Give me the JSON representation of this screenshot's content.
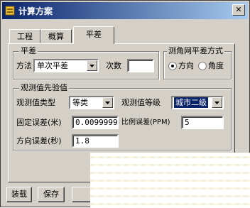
{
  "window": {
    "title": "计算方案"
  },
  "tabs": [
    {
      "label": "工程"
    },
    {
      "label": "概算"
    },
    {
      "label": "平差"
    }
  ],
  "adjust": {
    "group_title": "平差",
    "method_label": "方法",
    "method_value": "单次平差",
    "iterations_label": "次数",
    "iterations_value": ""
  },
  "angle_mode": {
    "group_title": "测角网平差方式",
    "option_direction": "方向",
    "option_angle": "角度",
    "selected": "方向"
  },
  "prior": {
    "group_title": "观测值先验值",
    "obs_type_label": "观测值类型",
    "obs_type_value": "等类",
    "obs_grade_label": "观测值等级",
    "obs_grade_value": "城市二级",
    "fixed_error_label": "固定误差(米)",
    "fixed_error_value": "0.0099999",
    "ratio_error_label": "比例误差(PPM)",
    "ratio_error_value": "5",
    "direction_error_label": "方向误差(秒)",
    "direction_error_value": "1.8"
  },
  "buttons": {
    "load": "装载",
    "save": "保存"
  }
}
